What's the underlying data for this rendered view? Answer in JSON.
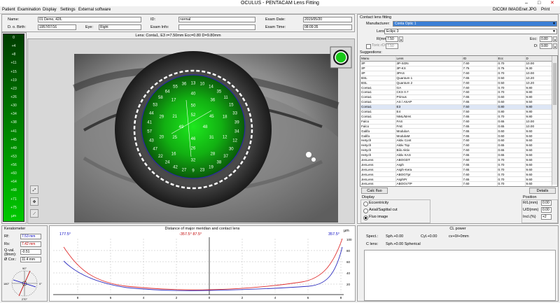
{
  "window": {
    "title": "OCULUS - PENTACAM   Lens Fitting",
    "min": "–",
    "max": "□",
    "close": "✕"
  },
  "menu": {
    "left": [
      "Patient",
      "Examination",
      "Display",
      "Settings",
      "External software"
    ],
    "right": [
      "DICOM",
      "IMAGEnet",
      "JPG",
      "Print"
    ]
  },
  "patient": {
    "name_label": "Name:",
    "name_value": "01 Demo, 42/L",
    "dob_label": "D. o. Birth:",
    "dob_value": "1957/07/16",
    "eye_label": "Eye:",
    "eye_value": "Right",
    "id_label": "ID:",
    "id_value": "normal",
    "info_label": "Exam Info:",
    "info_value": "",
    "date_label": "Exam Date:",
    "date_value": "2015/05/20",
    "time_label": "Exam Time:",
    "time_value": "08:09:35"
  },
  "lens_caption": "Lens:  Conta1, E3   r=7.50mm Ecc=0.80 D=9.80mm",
  "scale": {
    "values": [
      "0",
      "+4",
      "+8",
      "+11",
      "+15",
      "+19",
      "+23",
      "+26",
      "+30",
      "+34",
      "+38",
      "+41",
      "+45",
      "+49",
      "+53",
      "+56",
      "+60",
      "+64",
      "+68",
      "+71",
      "+75"
    ],
    "unit": "µm",
    "color_top": "#003c00",
    "color_bottom": "#00c800"
  },
  "fluo_numbers": [
    "52",
    "48",
    "46",
    "49",
    "50",
    "45",
    "31",
    "26",
    "25",
    "21",
    "40",
    "36",
    "18",
    "12",
    "28",
    "32",
    "16",
    "20",
    "29",
    "17",
    "13",
    "10",
    "14",
    "35",
    "11",
    "15",
    "33",
    "39",
    "34",
    "12",
    "30",
    "37",
    "38",
    "19",
    "23",
    "9",
    "27",
    "42",
    "24",
    "22",
    "47",
    "43",
    "57",
    "41",
    "44",
    "53",
    "58",
    "64",
    "55",
    "36"
  ],
  "ctl": {
    "title": "Contact lens fitting",
    "manufacturer_label": "Manufacturer:",
    "manufacturer_value": "Conta Optic 1",
    "lens_label": "Lens",
    "lens_value": "Eclipc 3",
    "r_label": "R(mm)",
    "r_value": "7.50",
    "ecc_label": "Ecc:",
    "ecc_value": "0.80",
    "torc_label": "Toric rD:",
    "torc_value": "7.50",
    "d_label": "D:",
    "d_value": "9.80",
    "suggestions_label": "Suggestions:",
    "columns": [
      "Manu",
      "Lens",
      "rD",
      "Ecc",
      "D"
    ],
    "rows": [
      [
        "3P",
        "3P-SON",
        "7.60",
        "0.70",
        "10.00"
      ],
      [
        "3P",
        "3P-KX",
        "7.75",
        "0.75",
        "9.30"
      ],
      [
        "3P",
        "3PAS",
        "7.60",
        "0.70",
        "10.00"
      ],
      [
        "BSL",
        "Quantum 1",
        "7.65",
        "0.50",
        "10.20"
      ],
      [
        "BSL",
        "Quantum 2",
        "7.60",
        "0.50",
        "10.20"
      ],
      [
        "Conta1",
        "GA",
        "7.60",
        "0.70",
        "9.80"
      ],
      [
        "Conta1",
        "CKX 0.7",
        "7.60",
        "0.70",
        "9.80"
      ],
      [
        "Conta1",
        "Primus",
        "7.65",
        "0.60",
        "9.80"
      ],
      [
        "Conta1",
        "AS / ASAP",
        "7.65",
        "0.60",
        "9.50"
      ],
      [
        "Conta1",
        "E3",
        "7.50",
        "0.80",
        "9.80"
      ],
      [
        "Conta1",
        "E4",
        "7.50",
        "0.80",
        "9.80"
      ],
      [
        "Conta1",
        "NML/MAK",
        "7.65",
        "0.70",
        "9.80"
      ],
      [
        "Falco",
        "FAS",
        "7.60",
        "0.65",
        "10.00"
      ],
      [
        "Falco",
        "FAE",
        "7.65",
        "0.65",
        "10.00"
      ],
      [
        "Galifa",
        "ModulaA",
        "7.65",
        "0.60",
        "9.60"
      ],
      [
        "Galifa",
        "ModulaM",
        "7.65",
        "0.60",
        "9.60"
      ],
      [
        "Hetych",
        "Aktiv Cont",
        "7.60",
        "0.60",
        "9.60"
      ],
      [
        "Hetych",
        "Aktiv Top",
        "7.60",
        "0.65",
        "9.60"
      ],
      [
        "Hetych",
        "Bilo Aktiv",
        "7.60",
        "0.65",
        "9.60"
      ],
      [
        "Hetych",
        "Aktiv KAS",
        "7.65",
        "0.65",
        "9.60"
      ],
      [
        "JenLens",
        "ABOGDT",
        "7.60",
        "0.70",
        "9.60"
      ],
      [
        "JenLens",
        "Asph",
        "7.65",
        "0.70",
        "9.60"
      ],
      [
        "JenLens",
        "Asph-Kera",
        "7.65",
        "0.70",
        "9.60"
      ],
      [
        "JenLens",
        "ABOGTpr",
        "7.60",
        "0.70",
        "9.60"
      ],
      [
        "JenLens",
        "AsphPr",
        "7.65",
        "0.70",
        "9.60"
      ],
      [
        "JenLens",
        "ABOGVTP",
        "7.60",
        "0.70",
        "9.60"
      ],
      [
        "JenLens",
        "AsphVTP",
        "7.60",
        "0.75",
        "9.60"
      ],
      [
        "JenLens",
        "JesAps",
        "7.60",
        "0.70",
        "9.60"
      ],
      [
        "JenLens",
        "JesAps VT",
        "7.60",
        "0.70",
        "9.60"
      ],
      [
        "MPG/M",
        "MivCAS 06",
        "7.60",
        "0.70",
        "9.60"
      ],
      [
        "MPG/M",
        "MivCAS 06",
        "7.60",
        "0.70",
        "9.60"
      ]
    ],
    "calc_label": "Calc fluo",
    "details_label": "Details",
    "display_label": "Display",
    "opt_ecc": "Eccentricity",
    "opt_axial": "Axial/Sagittal cut",
    "opt_fluo": "Fluo image",
    "position_label": "Position",
    "rl_label": "R/L(mm)",
    "rl_value": "0.00",
    "ud_label": "U/D(mm)",
    "ud_value": "0.00",
    "incl_label": "Incl.(%)",
    "incl_value": "+2"
  },
  "kerato": {
    "title": "Keratometer",
    "rf_label": "Rf:",
    "rf_value": "7.53 mm",
    "rs_label": "Rs:",
    "rs_value": "7.42 mm",
    "q_label": "Q-val.(8mm):",
    "q_value": "-0.51",
    "cor_label": "Ø Cor.:",
    "cor_value": "11.4 mm",
    "axis_top": "90°",
    "axis_left": "180°",
    "axis_right": "0°",
    "axis_bottom": "270°"
  },
  "distance": {
    "title": "Distance of major meridian and contact lens",
    "unit": "µm",
    "left_angle": "177.5°",
    "mid_angle": "-357.5°  87.5°",
    "right_angle": "357.5°",
    "x_ticks": [
      "8",
      "6",
      "4",
      "2",
      "0",
      "2",
      "4",
      "6",
      "8"
    ],
    "y_ticks": [
      "100",
      "80",
      "60",
      "40",
      "20"
    ]
  },
  "power": {
    "title": "CL power",
    "spect_label": "Spect.:",
    "spect_value": "Sph.+0.00",
    "cyl_value": "Cyl.+0.00",
    "cv_value": "cv+0/+0mm",
    "clens_label": "C lens:",
    "clens_value": "Sph.+0.00 Spherical"
  }
}
